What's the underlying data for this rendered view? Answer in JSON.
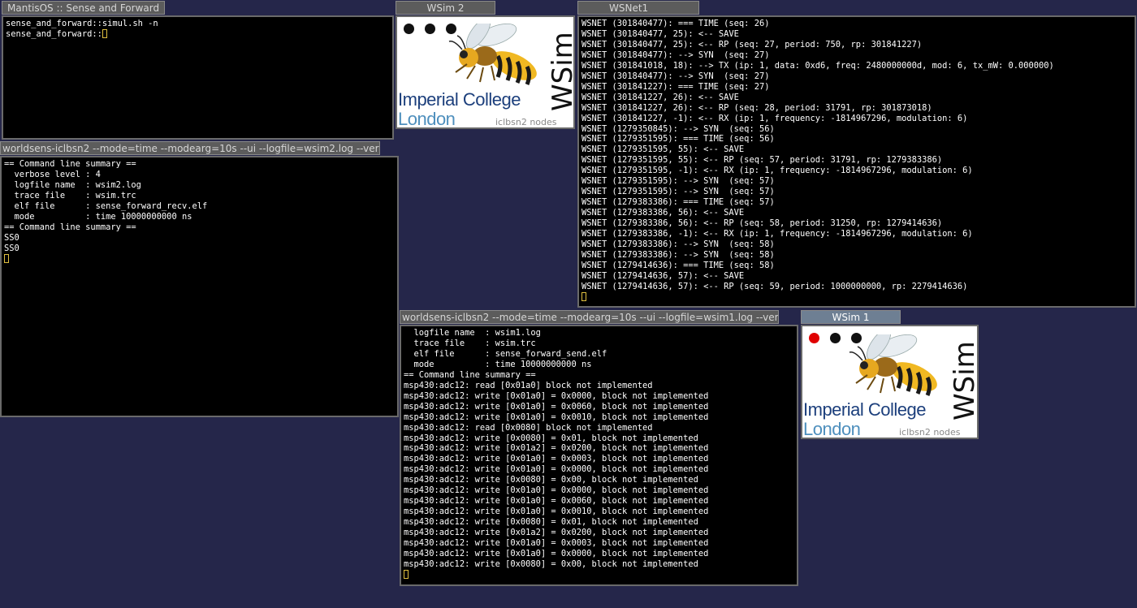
{
  "windows": {
    "mantis": {
      "title": "MantisOS :: Sense and Forward",
      "lines": [
        "sense_and_forward::simul.sh -n",
        "sense_and_forward::"
      ]
    },
    "wsim2": {
      "title": "WSim 2",
      "brand_line1": "Imperial College",
      "brand_line2": "London",
      "nodes_label": "iclbsn2 nodes",
      "side_label": "WSim",
      "led_states": [
        false,
        false,
        false
      ]
    },
    "wsnet1": {
      "title": "WSNet1",
      "lines": [
        "WSNET (301840477): === TIME (seq: 26)",
        "WSNET (301840477, 25): <-- SAVE",
        "WSNET (301840477, 25): <-- RP (seq: 27, period: 750, rp: 301841227)",
        "WSNET (301840477): --> SYN  (seq: 27)",
        "WSNET (301841018, 18): --> TX (ip: 1, data: 0xd6, freq: 2480000000d, mod: 6, tx_mW: 0.000000)",
        "WSNET (301840477): --> SYN  (seq: 27)",
        "WSNET (301841227): === TIME (seq: 27)",
        "WSNET (301841227, 26): <-- SAVE",
        "WSNET (301841227, 26): <-- RP (seq: 28, period: 31791, rp: 301873018)",
        "WSNET (301841227, -1): <-- RX (ip: 1, frequency: -1814967296, modulation: 6)",
        "WSNET (1279350845): --> SYN  (seq: 56)",
        "WSNET (1279351595): === TIME (seq: 56)",
        "WSNET (1279351595, 55): <-- SAVE",
        "WSNET (1279351595, 55): <-- RP (seq: 57, period: 31791, rp: 1279383386)",
        "WSNET (1279351595, -1): <-- RX (ip: 1, frequency: -1814967296, modulation: 6)",
        "WSNET (1279351595): --> SYN  (seq: 57)",
        "WSNET (1279351595): --> SYN  (seq: 57)",
        "WSNET (1279383386): === TIME (seq: 57)",
        "WSNET (1279383386, 56): <-- SAVE",
        "WSNET (1279383386, 56): <-- RP (seq: 58, period: 31250, rp: 1279414636)",
        "WSNET (1279383386, -1): <-- RX (ip: 1, frequency: -1814967296, modulation: 6)",
        "WSNET (1279383386): --> SYN  (seq: 58)",
        "WSNET (1279383386): --> SYN  (seq: 58)",
        "WSNET (1279414636): === TIME (seq: 58)",
        "WSNET (1279414636, 57): <-- SAVE",
        "WSNET (1279414636, 57): <-- RP (seq: 59, period: 1000000000, rp: 2279414636)"
      ]
    },
    "worldsens2": {
      "title": "worldsens-iclbsn2 --mode=time --modearg=10s --ui --logfile=wsim2.log --verbose...",
      "lines": [
        "== Command line summary ==",
        "  verbose level : 4",
        "  logfile name  : wsim2.log",
        "  trace file    : wsim.trc",
        "  elf file      : sense_forward_recv.elf",
        "  mode          : time 10000000000 ns",
        "== Command line summary ==",
        "SS0",
        "SS0"
      ]
    },
    "worldsens1": {
      "title": "worldsens-iclbsn2 --mode=time --modearg=10s --ui --logfile=wsim1.log --verbose...",
      "lines": [
        "  logfile name  : wsim1.log",
        "  trace file    : wsim.trc",
        "  elf file      : sense_forward_send.elf",
        "  mode          : time 10000000000 ns",
        "== Command line summary ==",
        "msp430:adc12: read [0x01a0] block not implemented",
        "msp430:adc12: write [0x01a0] = 0x0000, block not implemented",
        "msp430:adc12: write [0x01a0] = 0x0060, block not implemented",
        "msp430:adc12: write [0x01a0] = 0x0010, block not implemented",
        "msp430:adc12: read [0x0080] block not implemented",
        "msp430:adc12: write [0x0080] = 0x01, block not implemented",
        "msp430:adc12: write [0x01a2] = 0x0200, block not implemented",
        "msp430:adc12: write [0x01a0] = 0x0003, block not implemented",
        "msp430:adc12: write [0x01a0] = 0x0000, block not implemented",
        "msp430:adc12: write [0x0080] = 0x00, block not implemented",
        "msp430:adc12: write [0x01a0] = 0x0000, block not implemented",
        "msp430:adc12: write [0x01a0] = 0x0060, block not implemented",
        "msp430:adc12: write [0x01a0] = 0x0010, block not implemented",
        "msp430:adc12: write [0x0080] = 0x01, block not implemented",
        "msp430:adc12: write [0x01a2] = 0x0200, block not implemented",
        "msp430:adc12: write [0x01a0] = 0x0003, block not implemented",
        "msp430:adc12: write [0x01a0] = 0x0000, block not implemented",
        "msp430:adc12: write [0x0080] = 0x00, block not implemented"
      ]
    },
    "wsim1": {
      "title": "WSim 1",
      "brand_line1": "Imperial College",
      "brand_line2": "London",
      "nodes_label": "iclbsn2 nodes",
      "side_label": "WSim",
      "led_states": [
        true,
        false,
        false
      ]
    }
  },
  "colors": {
    "desktop": "#25264a",
    "led_on": "#e00000",
    "cursor": "#e0c040",
    "brand_dark": "#1c3f7c",
    "brand_light": "#4e8fbd"
  }
}
